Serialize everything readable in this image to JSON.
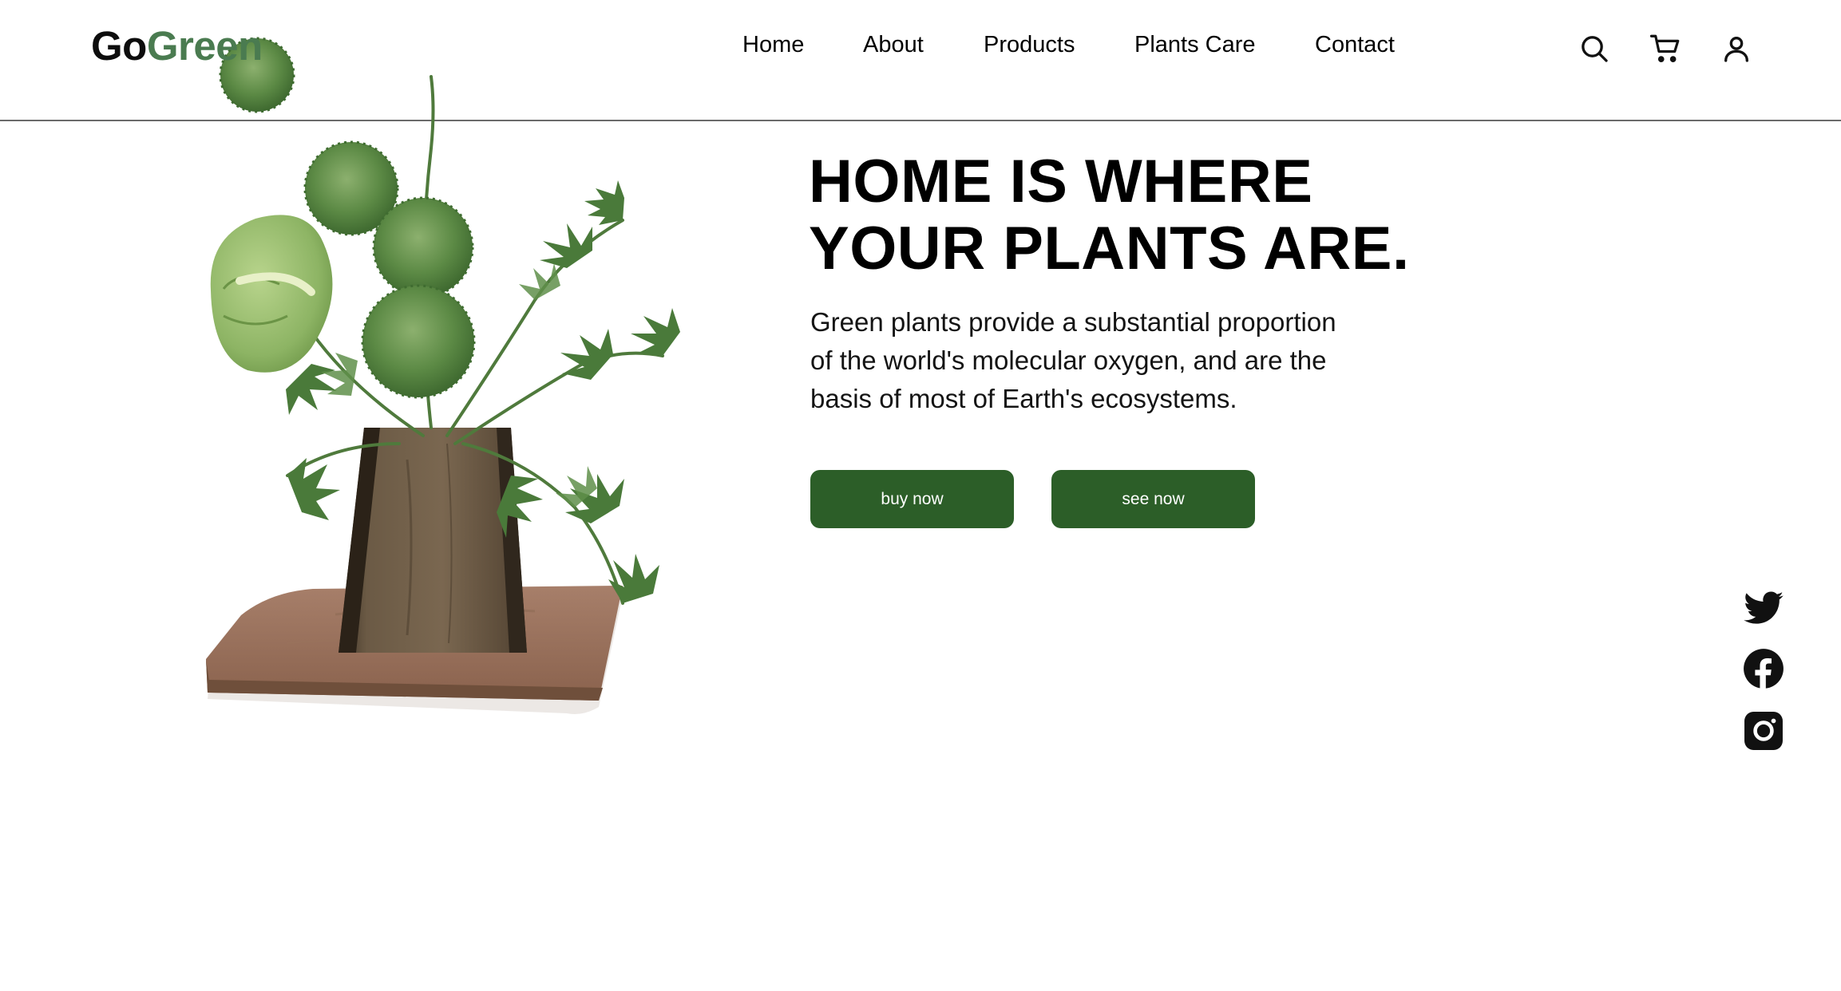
{
  "brand": {
    "part1": "Go",
    "part2": "Green",
    "accent_color": "#4a7b50"
  },
  "nav": {
    "items": [
      {
        "label": "Home"
      },
      {
        "label": "About"
      },
      {
        "label": "Products"
      },
      {
        "label": "Plants Care"
      },
      {
        "label": "Contact"
      }
    ]
  },
  "header_icons": [
    "search-icon",
    "cart-icon",
    "user-icon"
  ],
  "hero": {
    "headline_line1": "HOME IS WHERE",
    "headline_line2": "YOUR PLANTS ARE.",
    "description": "Green plants provide a substantial proportion of the world's molecular oxygen, and are the basis of most of Earth's ecosystems.",
    "buttons": {
      "buy_now": "buy now",
      "see_now": "see now"
    },
    "button_color": "#2c5e28"
  },
  "social_icons": [
    "twitter-icon",
    "facebook-icon",
    "instagram-icon"
  ]
}
